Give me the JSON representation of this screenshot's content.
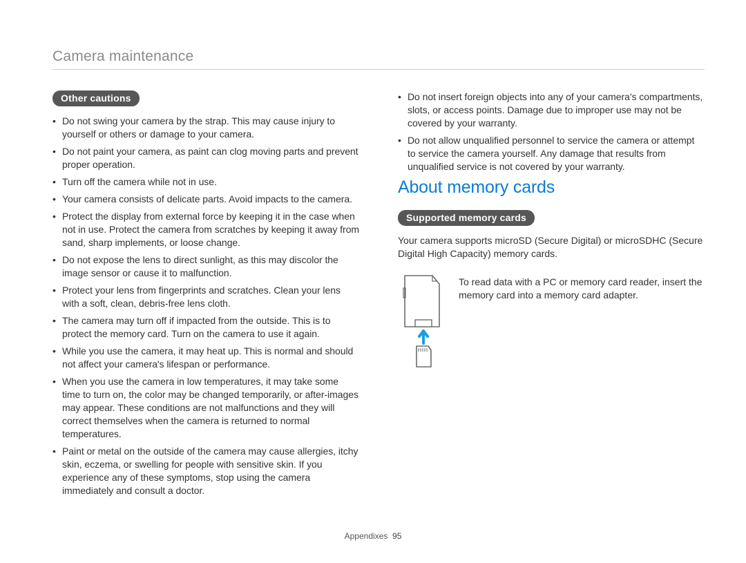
{
  "header": {
    "section_title": "Camera maintenance"
  },
  "left": {
    "pill_label": "Other cautions",
    "bullets": [
      "Do not swing your camera by the strap. This may cause injury to yourself or others or damage to your camera.",
      "Do not paint your camera, as paint can clog moving parts and prevent proper operation.",
      "Turn off the camera while not in use.",
      "Your camera consists of delicate parts. Avoid impacts to the camera.",
      "Protect the display from external force by keeping it in the case when not in use. Protect the camera from scratches by keeping it away from sand, sharp implements, or loose change.",
      "Do not expose the lens to direct sunlight, as this may discolor the image sensor or cause it to malfunction.",
      "Protect your lens from fingerprints and scratches. Clean your lens with a soft, clean, debris-free lens cloth.",
      "The camera may turn off if impacted from the outside. This is to protect the memory card. Turn on the camera to use it again.",
      "While you use the camera, it may heat up. This is normal and should not affect your camera's lifespan or performance.",
      "When you use the camera in low temperatures, it may take some time to turn on, the color may be changed temporarily, or after-images may appear. These conditions are not malfunctions and they will correct themselves when the camera is returned to normal temperatures.",
      "Paint or metal on the outside of the camera may cause allergies, itchy skin, eczema, or swelling for people with sensitive skin. If you experience any of these symptoms, stop using the camera immediately and consult a doctor."
    ]
  },
  "right": {
    "top_bullets": [
      "Do not insert foreign objects into any of your camera's compartments, slots, or access points. Damage due to improper use may not be covered by your warranty.",
      "Do not allow unqualified personnel to service the camera or attempt to service the camera yourself. Any damage that results from unqualified service is not covered by your warranty."
    ],
    "heading": "About memory cards",
    "pill_label": "Supported memory cards",
    "body": "Your camera supports microSD (Secure Digital) or microSDHC (Secure Digital High Capacity) memory cards.",
    "adapter_note": "To read data with a PC or memory card reader, insert the memory card into a memory card adapter."
  },
  "footer": {
    "label": "Appendixes",
    "page": "95"
  }
}
